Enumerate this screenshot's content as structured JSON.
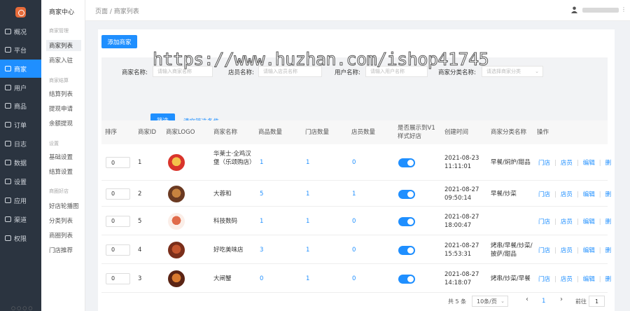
{
  "nav": {
    "items": [
      {
        "label": "概况",
        "icon": "overview-icon"
      },
      {
        "label": "平台",
        "icon": "platform-icon"
      },
      {
        "label": "商家",
        "icon": "store-icon",
        "active": true
      },
      {
        "label": "用户",
        "icon": "user-icon"
      },
      {
        "label": "商品",
        "icon": "goods-icon"
      },
      {
        "label": "订单",
        "icon": "order-icon"
      },
      {
        "label": "日志",
        "icon": "log-icon"
      },
      {
        "label": "数据",
        "icon": "data-icon"
      },
      {
        "label": "设置",
        "icon": "settings-icon"
      },
      {
        "label": "应用",
        "icon": "apps-icon"
      },
      {
        "label": "渠道",
        "icon": "channel-icon"
      },
      {
        "label": "权限",
        "icon": "permission-icon"
      }
    ]
  },
  "sub_nav": {
    "title": "商家中心",
    "groups": [
      {
        "label": "商家管理",
        "items": [
          "商家列表",
          "商家入驻"
        ]
      },
      {
        "label": "商家结算",
        "items": [
          "结算列表",
          "提现申请",
          "余额提现"
        ]
      },
      {
        "label": "设置",
        "items": [
          "基础设置",
          "结算设置"
        ]
      },
      {
        "label": "商圈好店",
        "items": [
          "好店轮播图",
          "分类列表",
          "商圈列表",
          "门店推荐"
        ]
      }
    ]
  },
  "topbar": {
    "breadcrumb": "页面 / 商家列表"
  },
  "toolbar": {
    "add_label": "添加商家"
  },
  "filter": {
    "store_name_label": "商家名称:",
    "store_name_placeholder": "请输入商家名称",
    "clerk_label": "店员名称:",
    "clerk_placeholder": "请输入店员名称",
    "user_label": "用户名称:",
    "user_placeholder": "请输入用户名称",
    "category_label": "商家分类名称:",
    "category_placeholder": "请选择商家分类",
    "submit_label": "筛选",
    "clear_label": "清空筛选条件"
  },
  "table": {
    "headers": [
      "排序",
      "商家ID",
      "商家LOGO",
      "商家名称",
      "商品数量",
      "门店数量",
      "店员数量",
      "是否展示到V1样式好店",
      "创建时间",
      "商家分类名称",
      "操作"
    ],
    "rows": [
      {
        "sort": "0",
        "id": "1",
        "name": "华莱士·全鸡汉堡（乐颂购店）",
        "goods": "1",
        "stores": "1",
        "clerks": "0",
        "time": "2021-08-23 11:11:01",
        "category": "早餐/焖炉/甜品"
      },
      {
        "sort": "0",
        "id": "2",
        "name": "大蓉和",
        "goods": "5",
        "stores": "1",
        "clerks": "1",
        "time": "2021-08-27 09:50:14",
        "category": "早餐/炒菜"
      },
      {
        "sort": "0",
        "id": "5",
        "name": "科技数码",
        "goods": "1",
        "stores": "1",
        "clerks": "0",
        "time": "2021-08-27 18:00:47",
        "category": ""
      },
      {
        "sort": "0",
        "id": "4",
        "name": "好吃美味店",
        "goods": "3",
        "stores": "1",
        "clerks": "0",
        "time": "2021-08-27 15:53:31",
        "category": "烤串/早餐/炒菜/披萨/甜品"
      },
      {
        "sort": "0",
        "id": "3",
        "name": "大闸蟹",
        "goods": "0",
        "stores": "1",
        "clerks": "0",
        "time": "2021-08-27 14:18:07",
        "category": "烤串/炒菜/早餐"
      }
    ],
    "ops": {
      "store": "门店",
      "clerk": "店员",
      "edit": "编辑",
      "more": "删"
    }
  },
  "pagination": {
    "total": "共 5 条",
    "page_size": "10条/页",
    "prev": "‹",
    "current": "1",
    "next": "›",
    "goto_label": "前往",
    "goto_value": "1"
  },
  "watermark": "https://www.huzhan.com/ishop41745",
  "colors": {
    "primary": "#1f8fff",
    "sidebar": "#2b3440"
  }
}
